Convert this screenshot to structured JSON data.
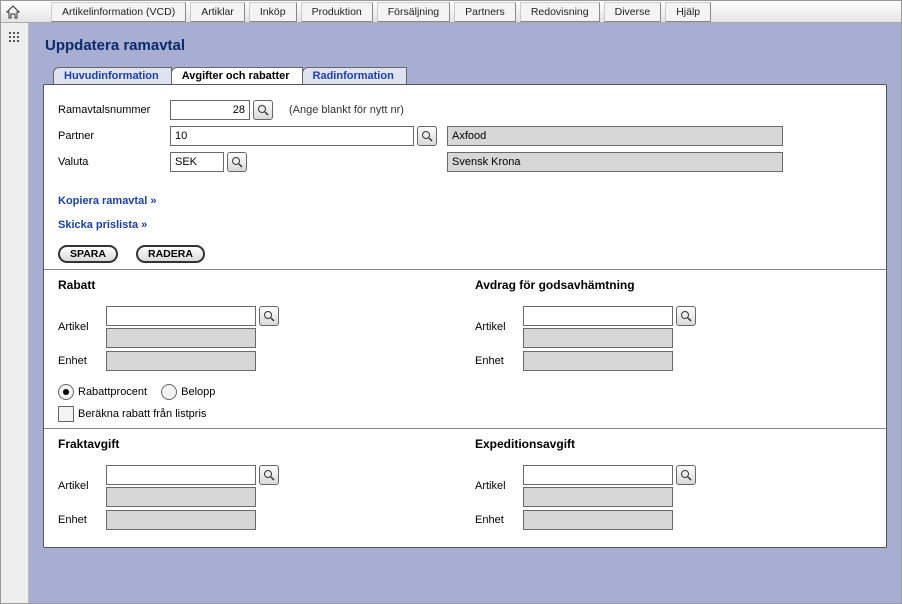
{
  "topnav": {
    "items": [
      "Artikelinformation (VCD)",
      "Artiklar",
      "Inköp",
      "Produktion",
      "Försäljning",
      "Partners",
      "Redovisning",
      "Diverse",
      "Hjälp"
    ]
  },
  "page": {
    "title": "Uppdatera ramavtal"
  },
  "tabs": {
    "t0": "Huvudinformation",
    "t1": "Avgifter och rabatter",
    "t2": "Radinformation"
  },
  "head": {
    "ramavtal_label": "Ramavtalsnummer",
    "ramavtal_value": "28",
    "ramavtal_hint": "(Ange blankt för nytt nr)",
    "partner_label": "Partner",
    "partner_value": "10",
    "partner_name": "Axfood",
    "valuta_label": "Valuta",
    "valuta_value": "SEK",
    "valuta_name": "Svensk Krona"
  },
  "actions": {
    "copy": "Kopiera ramavtal »",
    "send": "Skicka prislista »",
    "save": "SPARA",
    "delete": "RADERA"
  },
  "sections": {
    "rabatt": {
      "title": "Rabatt",
      "artikel_label": "Artikel",
      "artikel_value": "",
      "artikel_name": "",
      "enhet_label": "Enhet",
      "enhet_value": "",
      "opt_percent": "Rabattprocent",
      "opt_amount": "Belopp",
      "chk_listprice": "Beräkna rabatt från listpris"
    },
    "avdrag": {
      "title": "Avdrag för godsavhämtning",
      "artikel_label": "Artikel",
      "artikel_value": "",
      "artikel_name": "",
      "enhet_label": "Enhet",
      "enhet_value": ""
    },
    "frakt": {
      "title": "Fraktavgift",
      "artikel_label": "Artikel",
      "artikel_value": "",
      "artikel_name": "",
      "enhet_label": "Enhet",
      "enhet_value": ""
    },
    "exped": {
      "title": "Expeditionsavgift",
      "artikel_label": "Artikel",
      "artikel_value": "",
      "artikel_name": "",
      "enhet_label": "Enhet",
      "enhet_value": ""
    }
  }
}
